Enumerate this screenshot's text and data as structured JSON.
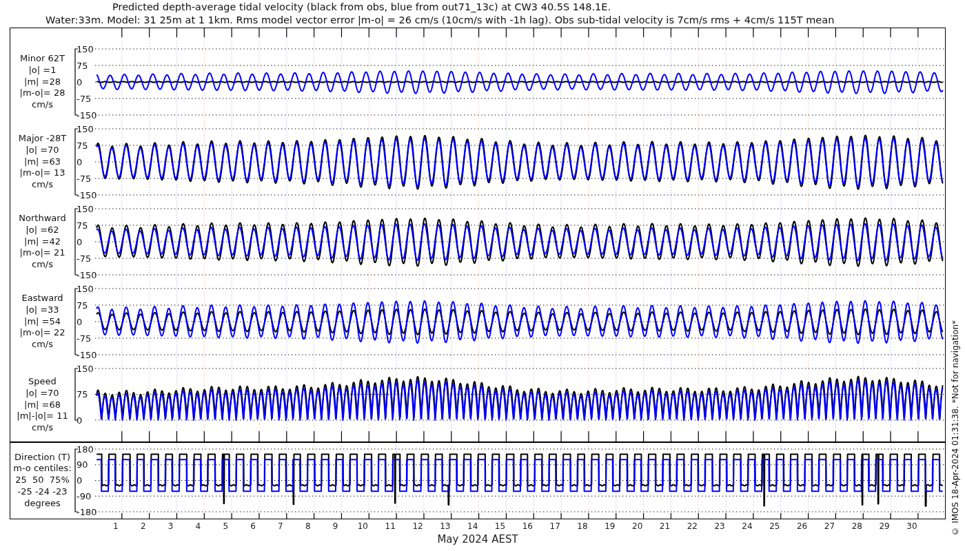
{
  "title": "Predicted depth-average tidal velocity (black from obs, blue from out71_13c) at CW3 40.5S 148.1E.",
  "subtitle": "Water:33m. Model: 31 25m at 1 1km. Rms model vector error |m-o| = 26 cm/s (10cm/s with -1h lag). Obs sub-tidal velocity is 7cm/s rms + 4cm/s 115T mean",
  "panels": [
    {
      "kind": "velocity",
      "label_lines": [
        "Minor 62T",
        "|o| =1",
        "|m| =28",
        "|m-o|= 28",
        "cm/s"
      ],
      "yticks": [
        "150",
        "75",
        "0",
        "-75",
        "-150"
      ]
    },
    {
      "kind": "velocity",
      "label_lines": [
        "Major -28T",
        "|o| =70",
        "|m| =63",
        "|m-o|= 13",
        "cm/s"
      ],
      "yticks": [
        "150",
        "75",
        "0",
        "-75",
        "-150"
      ]
    },
    {
      "kind": "velocity",
      "label_lines": [
        "Northward",
        "|o| =62",
        "|m| =42",
        "|m-o|= 21",
        "cm/s"
      ],
      "yticks": [
        "150",
        "75",
        "0",
        "-75",
        "-150"
      ]
    },
    {
      "kind": "velocity",
      "label_lines": [
        "Eastward",
        "|o| =33",
        "|m| =54",
        "|m-o|= 22",
        "cm/s"
      ],
      "yticks": [
        "150",
        "75",
        "0",
        "-75",
        "-150"
      ]
    },
    {
      "kind": "speed",
      "label_lines": [
        "Speed",
        "|o| =70",
        "|m| =68",
        "|m|-|o|= 11",
        "cm/s"
      ],
      "yticks": [
        "150",
        "75",
        "0"
      ]
    },
    {
      "kind": "direction",
      "label_lines": [
        "Direction (T)",
        "m-o centiles:",
        "25  50  75%",
        "-25 -24 -23",
        "degrees"
      ],
      "yticks": [
        "180",
        "90",
        "0",
        "-90",
        "-180"
      ]
    }
  ],
  "x_axis": {
    "ticks": [
      "1",
      "2",
      "3",
      "4",
      "5",
      "6",
      "7",
      "8",
      "9",
      "10",
      "11",
      "12",
      "13",
      "14",
      "15",
      "16",
      "17",
      "18",
      "19",
      "20",
      "21",
      "22",
      "23",
      "24",
      "25",
      "26",
      "27",
      "28",
      "29",
      "30"
    ],
    "label": "May 2024 AEST"
  },
  "credit": "© IMOS 18-Apr-2024 01:31:38. *Not for navigation*"
}
